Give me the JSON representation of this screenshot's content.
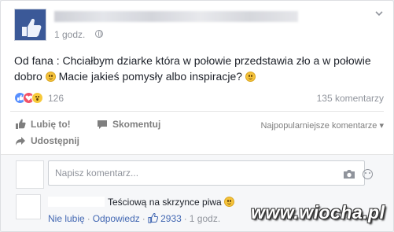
{
  "post": {
    "time": "1 godz.",
    "text_main": "Od fana : Chciałbym dziarke która w połowie przedstawia zło a w połowie dobro",
    "text_rest": "Macie jakieś pomysły albo inspiracje?"
  },
  "reactions": {
    "count": "126",
    "types": [
      "like-icon",
      "love-icon",
      "wow-icon"
    ],
    "comments": "135 komentarzy"
  },
  "actions": {
    "like": "Lubię to!",
    "comment": "Skomentuj",
    "share": "Udostępnij",
    "sort": "Najpopularniejsze komentarze ▾"
  },
  "composer": {
    "placeholder": "Napisz komentarz..."
  },
  "comment": {
    "text": "Teściową na skrzynce piwa",
    "unlike": "Nie lubię",
    "reply": "Odpowiedz",
    "likes": "2933",
    "time": "1 godz."
  },
  "watermark": "www.wiocha.pl",
  "colors": {
    "link": "#4267b2",
    "muted": "#90949c",
    "like_blue": "#5890ff",
    "love_red": "#f25268",
    "wow_yellow": "#f7c93a"
  }
}
